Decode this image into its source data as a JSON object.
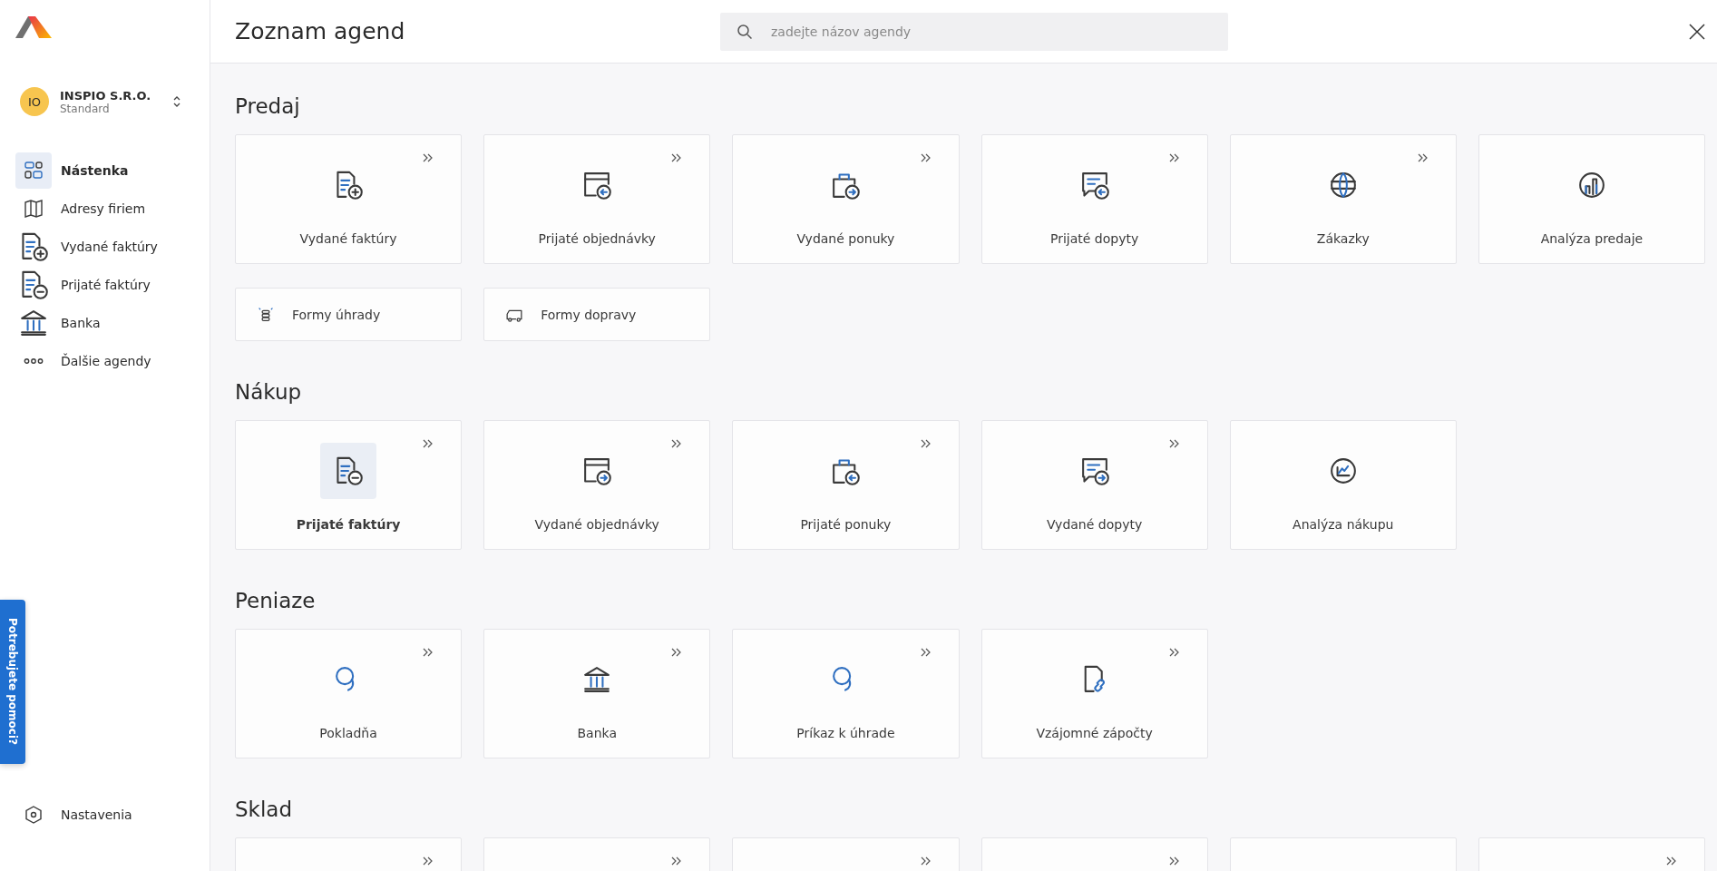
{
  "sidebar": {
    "organization": {
      "initials": "IO",
      "name": "INSPIO S.R.O.",
      "plan": "Standard"
    },
    "items": [
      {
        "label": "Nástenka",
        "selected": true
      },
      {
        "label": "Adresy firiem",
        "selected": false
      },
      {
        "label": "Vydané faktúry",
        "selected": false
      },
      {
        "label": "Prijaté faktúry",
        "selected": false
      },
      {
        "label": "Banka",
        "selected": false
      },
      {
        "label": "Ďalšie agendy",
        "selected": false
      }
    ],
    "help_tab": "Potrebujete pomoci?",
    "settings": "Nastavenia"
  },
  "header": {
    "title": "Zoznam agend",
    "search": {
      "placeholder": "zadejte názov agendy"
    }
  },
  "sections": [
    {
      "title": "Predaj",
      "cards": [
        {
          "kind": "large",
          "label": "Vydané faktúry",
          "selected": false,
          "has_submenu": true
        },
        {
          "kind": "large",
          "label": "Prijaté objednávky",
          "selected": false,
          "has_submenu": true
        },
        {
          "kind": "large",
          "label": "Vydané ponuky",
          "selected": false,
          "has_submenu": true
        },
        {
          "kind": "large",
          "label": "Prijaté dopyty",
          "selected": false,
          "has_submenu": true
        },
        {
          "kind": "large",
          "label": "Zákazky",
          "selected": false,
          "has_submenu": true
        },
        {
          "kind": "large",
          "label": "Analýza predaje",
          "selected": false,
          "has_submenu": false
        },
        {
          "kind": "small",
          "label": "Formy úhrady",
          "selected": false,
          "has_submenu": false
        },
        {
          "kind": "small",
          "label": "Formy dopravy",
          "selected": false,
          "has_submenu": false
        }
      ]
    },
    {
      "title": "Nákup",
      "cards": [
        {
          "kind": "large",
          "label": "Prijaté faktúry",
          "selected": true,
          "has_submenu": true
        },
        {
          "kind": "large",
          "label": "Vydané objednávky",
          "selected": false,
          "has_submenu": true
        },
        {
          "kind": "large",
          "label": "Prijaté ponuky",
          "selected": false,
          "has_submenu": true
        },
        {
          "kind": "large",
          "label": "Vydané dopyty",
          "selected": false,
          "has_submenu": true
        },
        {
          "kind": "large",
          "label": "Analýza nákupu",
          "selected": false,
          "has_submenu": false
        }
      ]
    },
    {
      "title": "Peniaze",
      "cards": [
        {
          "kind": "large",
          "label": "Pokladňa",
          "selected": false,
          "has_submenu": true
        },
        {
          "kind": "large",
          "label": "Banka",
          "selected": false,
          "has_submenu": true
        },
        {
          "kind": "large",
          "label": "Príkaz k úhrade",
          "selected": false,
          "has_submenu": true
        },
        {
          "kind": "large",
          "label": "Vzájomné zápočty",
          "selected": false,
          "has_submenu": true
        }
      ]
    },
    {
      "title": "Sklad",
      "cards": [
        {
          "kind": "large",
          "has_submenu": true
        },
        {
          "kind": "large",
          "has_submenu": true
        },
        {
          "kind": "large",
          "has_submenu": true
        },
        {
          "kind": "large",
          "has_submenu": true
        },
        {
          "kind": "large",
          "has_submenu": false
        },
        {
          "kind": "large",
          "has_submenu": true
        }
      ]
    }
  ]
}
